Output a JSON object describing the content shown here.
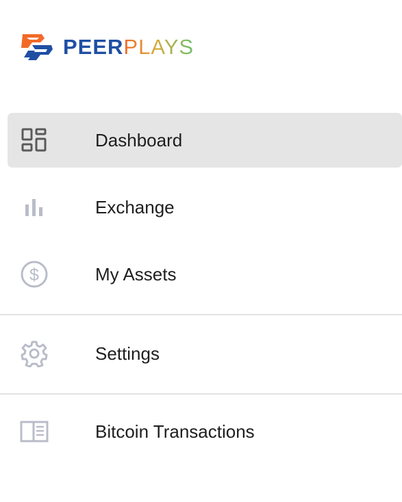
{
  "brand": {
    "name_part1": "PEER",
    "name_part2": "PLAYS",
    "logo_icon": "peerplays-logo-icon"
  },
  "nav": {
    "items": [
      {
        "label": "Dashboard",
        "icon": "dashboard-icon",
        "active": true
      },
      {
        "label": "Exchange",
        "icon": "bar-chart-icon",
        "active": false
      },
      {
        "label": "My Assets",
        "icon": "dollar-circle-icon",
        "active": false
      },
      {
        "label": "Settings",
        "icon": "gear-icon",
        "active": false
      },
      {
        "label": "Bitcoin Transactions",
        "icon": "book-icon",
        "active": false
      }
    ]
  },
  "colors": {
    "brand_blue": "#1f4fa3",
    "brand_orange": "#f26a28",
    "brand_green": "#6cc06c",
    "active_bg": "#e5e5e5",
    "icon_active": "#5a5a5a",
    "icon_inactive": "#b9bcc9",
    "divider": "#e2e2e2"
  }
}
